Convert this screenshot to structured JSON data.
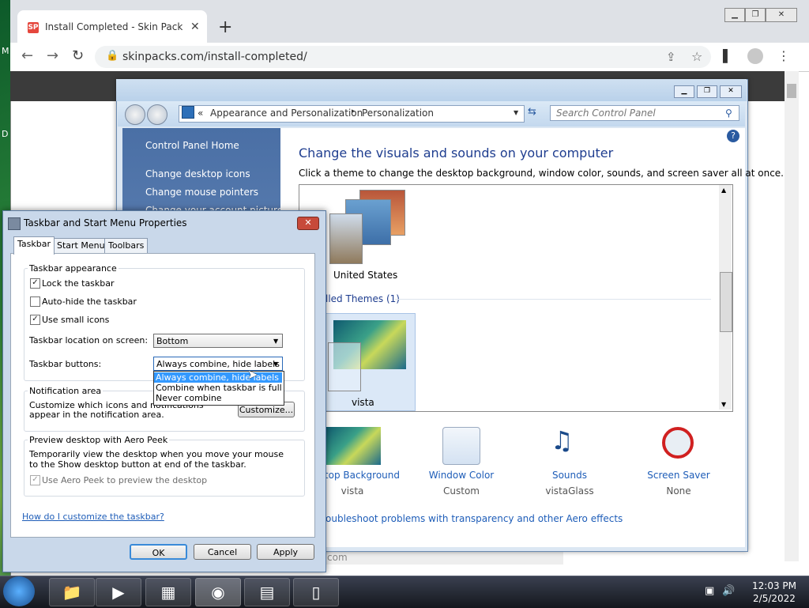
{
  "browser": {
    "tab_title": "Install Completed - Skin Pack Th",
    "favicon": "SP",
    "url": "skinpacks.com/install-completed/",
    "status_text": "com"
  },
  "desktop": {
    "label_m": "M",
    "label_d": "D"
  },
  "control_panel": {
    "breadcrumb_prefix": "«",
    "breadcrumb_1": "Appearance and Personalization",
    "breadcrumb_sep": "▸",
    "breadcrumb_2": "Personalization",
    "search_placeholder": "Search Control Panel",
    "left_links": [
      "Control Panel Home",
      "Change desktop icons",
      "Change mouse pointers",
      "Change your account picture"
    ],
    "heading": "Change the visuals and sounds on your computer",
    "subheading": "Click a theme to change the desktop background, window color, sounds, and screen saver all at once.",
    "theme_1": "United States",
    "installed_header": "lled Themes (1)",
    "theme_2": "vista",
    "items": [
      {
        "label": "ktop Background",
        "value": "vista"
      },
      {
        "label": "Window Color",
        "value": "Custom"
      },
      {
        "label": "Sounds",
        "value": "vistaGlass"
      },
      {
        "label": "Screen Saver",
        "value": "None"
      }
    ],
    "troubleshoot": "oubleshoot problems with transparency and other Aero effects"
  },
  "dialog": {
    "title": "Taskbar and Start Menu Properties",
    "tabs": [
      "Taskbar",
      "Start Menu",
      "Toolbars"
    ],
    "group_appearance": "Taskbar appearance",
    "lock": "Lock the taskbar",
    "autohide": "Auto-hide the taskbar",
    "small_icons": "Use small icons",
    "location_label": "Taskbar location on screen:",
    "location_value": "Bottom",
    "buttons_label": "Taskbar buttons:",
    "buttons_value": "Always combine, hide labels",
    "dropdown_options": [
      "Always combine, hide labels",
      "Combine when taskbar is full",
      "Never combine"
    ],
    "group_notification": "Notification area",
    "notification_text": "Customize which icons and notifications appear in the notification area.",
    "customize_btn": "Customize...",
    "group_peek": "Preview desktop with Aero Peek",
    "peek_text": "Temporarily view the desktop when you move your mouse to the Show desktop button at end of the taskbar.",
    "peek_check": "Use Aero Peek to preview the desktop",
    "help_link": "How do I customize the taskbar?",
    "ok": "OK",
    "cancel": "Cancel",
    "apply": "Apply"
  },
  "taskbar": {
    "time": "12:03 PM",
    "date": "2/5/2022"
  }
}
